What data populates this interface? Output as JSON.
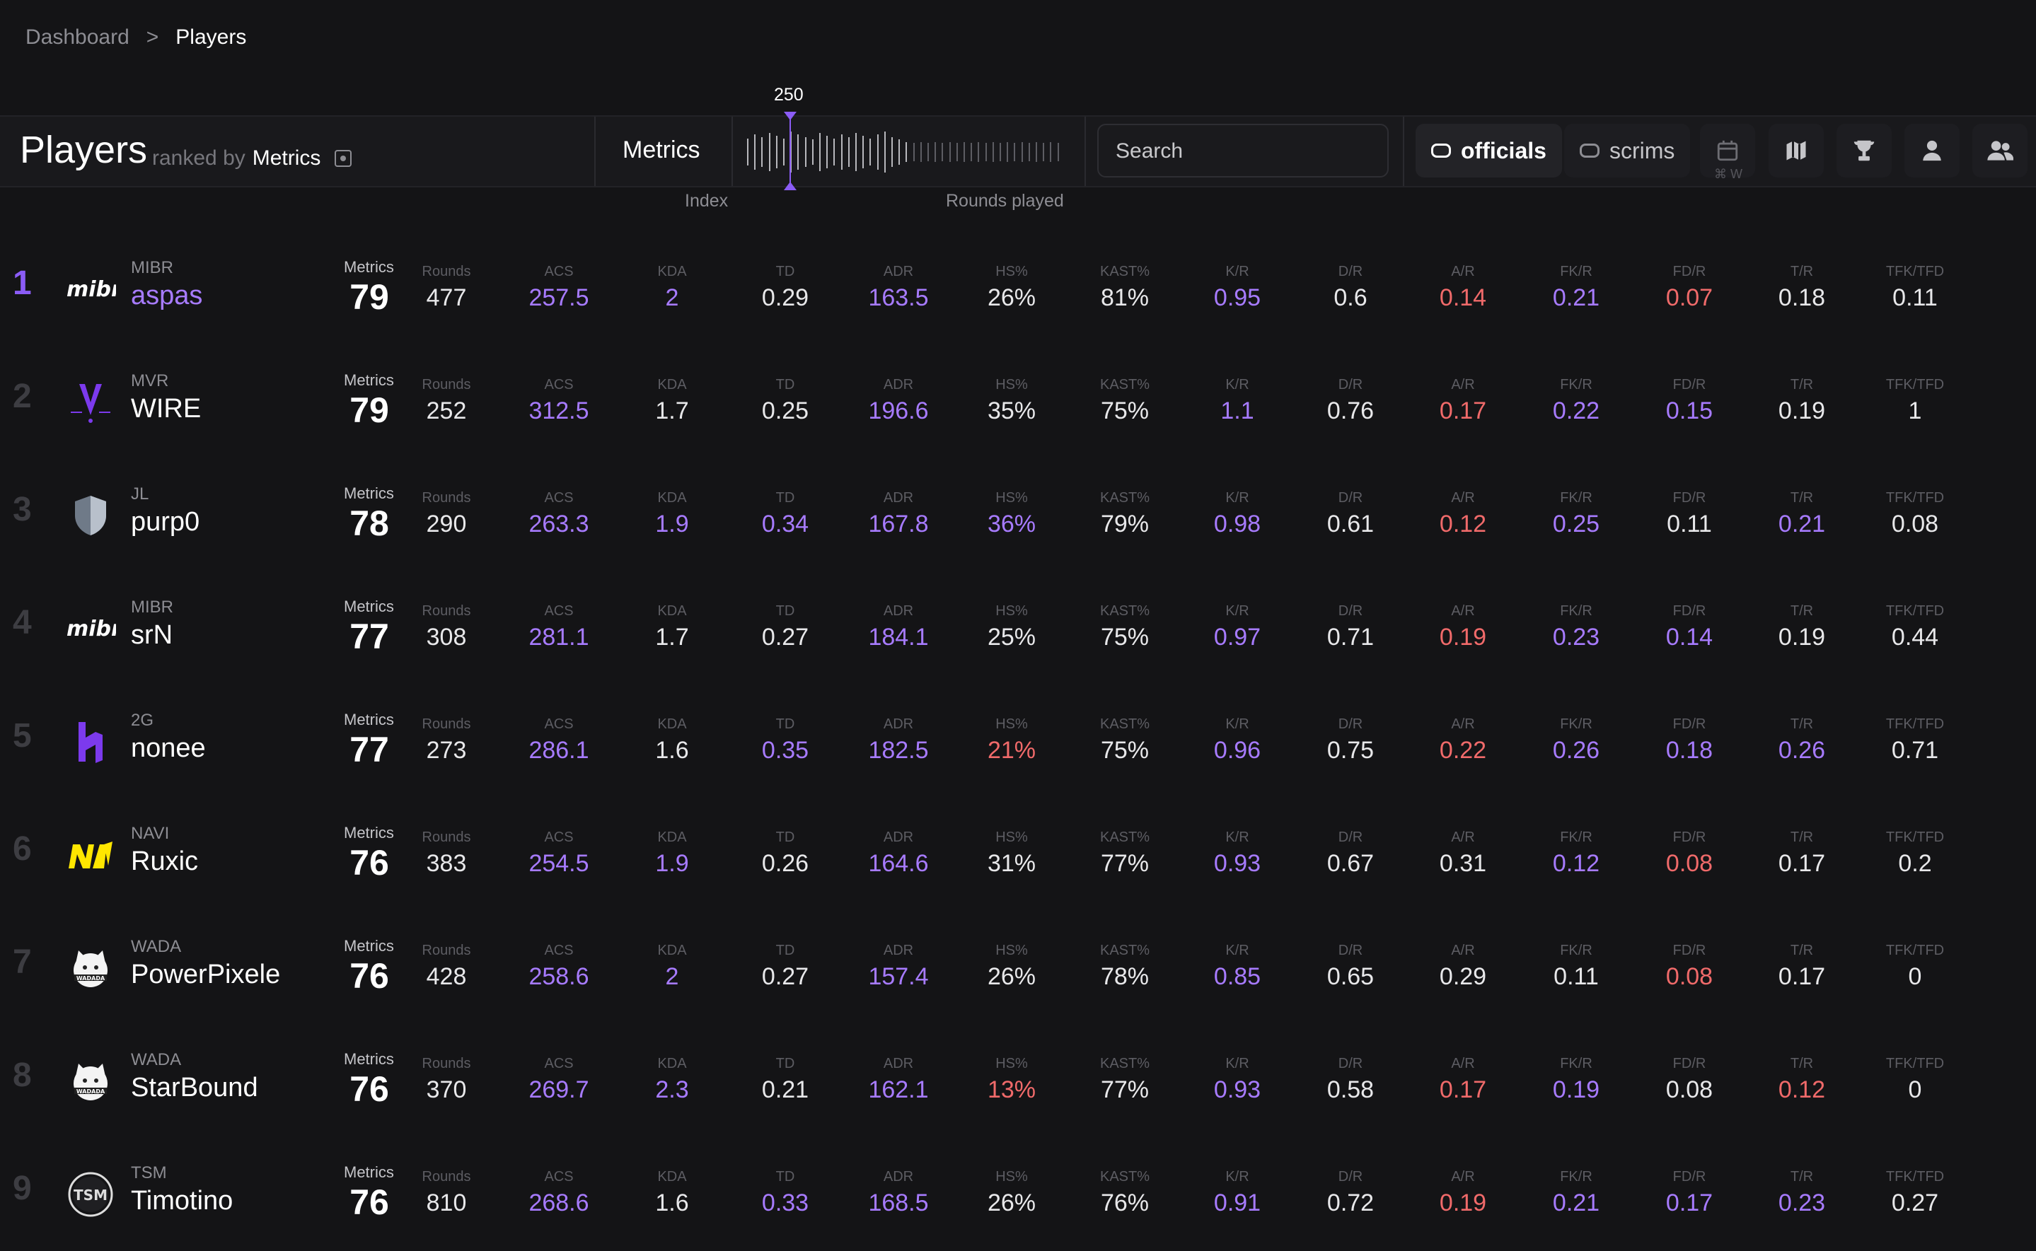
{
  "breadcrumb": {
    "parent": "Dashboard",
    "separator": ">",
    "current": "Players"
  },
  "header": {
    "title": "Players",
    "ranked_by_prefix": "ranked by",
    "ranked_by_value": "Metrics",
    "metric_selector": "Metrics",
    "slider_value": "250",
    "slider_left_label": "Index",
    "slider_right_label": "Rounds played",
    "search_placeholder": "Search",
    "filter_officials": "officials",
    "filter_scrims": "scrims",
    "shortcut_hint": "⌘ W"
  },
  "columns": [
    "Rounds",
    "ACS",
    "KDA",
    "TD",
    "ADR",
    "HS%",
    "KAST%",
    "K/R",
    "D/R",
    "A/R",
    "FK/R",
    "FD/R",
    "T/R",
    "TFK/TFD"
  ],
  "metrics_label": "Metrics",
  "colors": {
    "accent": "#8b5cf6",
    "positive": "#a77bff",
    "negative": "#f06a6a",
    "background": "#141416"
  },
  "players": [
    {
      "rank": "1",
      "team": "MIBR",
      "name": "aspas",
      "logo": "mibr",
      "metrics": "79",
      "values": [
        "477",
        "257.5",
        "2",
        "0.29",
        "163.5",
        "26%",
        "81%",
        "0.95",
        "0.6",
        "0.14",
        "0.21",
        "0.07",
        "0.18",
        "0.11"
      ],
      "colors": [
        "n",
        "p",
        "p",
        "n",
        "p",
        "n",
        "n",
        "p",
        "n",
        "r",
        "p",
        "r",
        "n",
        "n"
      ]
    },
    {
      "rank": "2",
      "team": "MVR",
      "name": "WIRE",
      "logo": "mvr",
      "metrics": "79",
      "values": [
        "252",
        "312.5",
        "1.7",
        "0.25",
        "196.6",
        "35%",
        "75%",
        "1.1",
        "0.76",
        "0.17",
        "0.22",
        "0.15",
        "0.19",
        "1"
      ],
      "colors": [
        "n",
        "p",
        "n",
        "n",
        "p",
        "n",
        "n",
        "p",
        "n",
        "r",
        "p",
        "p",
        "n",
        "n"
      ]
    },
    {
      "rank": "3",
      "team": "JL",
      "name": "purp0",
      "logo": "jl",
      "metrics": "78",
      "values": [
        "290",
        "263.3",
        "1.9",
        "0.34",
        "167.8",
        "36%",
        "79%",
        "0.98",
        "0.61",
        "0.12",
        "0.25",
        "0.11",
        "0.21",
        "0.08"
      ],
      "colors": [
        "n",
        "p",
        "p",
        "p",
        "p",
        "p",
        "n",
        "p",
        "n",
        "r",
        "p",
        "n",
        "p",
        "n"
      ]
    },
    {
      "rank": "4",
      "team": "MIBR",
      "name": "srN",
      "logo": "mibr",
      "metrics": "77",
      "values": [
        "308",
        "281.1",
        "1.7",
        "0.27",
        "184.1",
        "25%",
        "75%",
        "0.97",
        "0.71",
        "0.19",
        "0.23",
        "0.14",
        "0.19",
        "0.44"
      ],
      "colors": [
        "n",
        "p",
        "n",
        "n",
        "p",
        "n",
        "n",
        "p",
        "n",
        "r",
        "p",
        "p",
        "n",
        "n"
      ]
    },
    {
      "rank": "5",
      "team": "2G",
      "name": "nonee",
      "logo": "2g",
      "metrics": "77",
      "values": [
        "273",
        "286.1",
        "1.6",
        "0.35",
        "182.5",
        "21%",
        "75%",
        "0.96",
        "0.75",
        "0.22",
        "0.26",
        "0.18",
        "0.26",
        "0.71"
      ],
      "colors": [
        "n",
        "p",
        "n",
        "p",
        "p",
        "r",
        "n",
        "p",
        "n",
        "r",
        "p",
        "p",
        "p",
        "n"
      ]
    },
    {
      "rank": "6",
      "team": "NAVI",
      "name": "Ruxic",
      "logo": "navi",
      "metrics": "76",
      "values": [
        "383",
        "254.5",
        "1.9",
        "0.26",
        "164.6",
        "31%",
        "77%",
        "0.93",
        "0.67",
        "0.31",
        "0.12",
        "0.08",
        "0.17",
        "0.2"
      ],
      "colors": [
        "n",
        "p",
        "p",
        "n",
        "p",
        "n",
        "n",
        "p",
        "n",
        "n",
        "p",
        "r",
        "n",
        "n"
      ]
    },
    {
      "rank": "7",
      "team": "WADA",
      "name": "PowerPixele",
      "logo": "wada",
      "metrics": "76",
      "values": [
        "428",
        "258.6",
        "2",
        "0.27",
        "157.4",
        "26%",
        "78%",
        "0.85",
        "0.65",
        "0.29",
        "0.11",
        "0.08",
        "0.17",
        "0"
      ],
      "colors": [
        "n",
        "p",
        "p",
        "n",
        "p",
        "n",
        "n",
        "p",
        "n",
        "n",
        "n",
        "r",
        "n",
        "n"
      ]
    },
    {
      "rank": "8",
      "team": "WADA",
      "name": "StarBound",
      "logo": "wada",
      "metrics": "76",
      "values": [
        "370",
        "269.7",
        "2.3",
        "0.21",
        "162.1",
        "13%",
        "77%",
        "0.93",
        "0.58",
        "0.17",
        "0.19",
        "0.08",
        "0.12",
        "0"
      ],
      "colors": [
        "n",
        "p",
        "p",
        "n",
        "p",
        "r",
        "n",
        "p",
        "n",
        "r",
        "p",
        "n",
        "r",
        "n"
      ]
    },
    {
      "rank": "9",
      "team": "TSM",
      "name": "Timotino",
      "logo": "tsm",
      "metrics": "76",
      "values": [
        "810",
        "268.6",
        "1.6",
        "0.33",
        "168.5",
        "26%",
        "76%",
        "0.91",
        "0.72",
        "0.19",
        "0.21",
        "0.17",
        "0.23",
        "0.27"
      ],
      "colors": [
        "n",
        "p",
        "n",
        "p",
        "p",
        "n",
        "n",
        "p",
        "n",
        "r",
        "p",
        "p",
        "p",
        "n"
      ]
    }
  ]
}
